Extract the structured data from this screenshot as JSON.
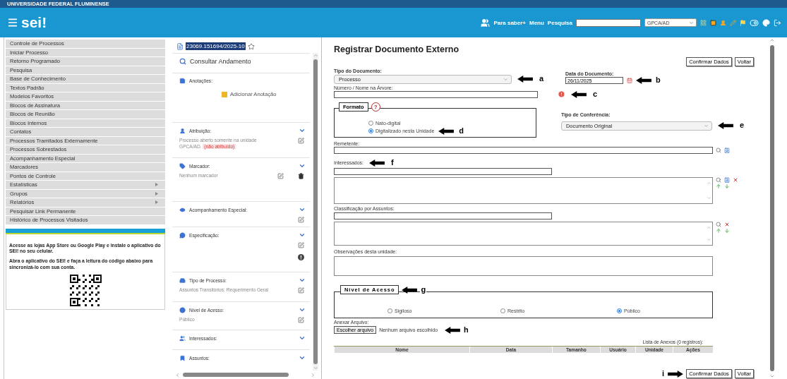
{
  "header": {
    "institution": "UNIVERSIDADE FEDERAL FLUMINENSE",
    "logo": "sei!",
    "links": [
      "Para saber+",
      "Menu",
      "Pesquisa"
    ],
    "unit": "GPCA/AD"
  },
  "sidebar": {
    "menu": [
      {
        "label": "Controle de Processos",
        "has_submenu": false
      },
      {
        "label": "Iniciar Processo",
        "has_submenu": false
      },
      {
        "label": "Retorno Programado",
        "has_submenu": false
      },
      {
        "label": "Pesquisa",
        "has_submenu": false
      },
      {
        "label": "Base de Conhecimento",
        "has_submenu": false
      },
      {
        "label": "Textos Padrão",
        "has_submenu": false
      },
      {
        "label": "Modelos Favoritos",
        "has_submenu": false
      },
      {
        "label": "Blocos de Assinatura",
        "has_submenu": false
      },
      {
        "label": "Blocos de Reunião",
        "has_submenu": false
      },
      {
        "label": "Blocos Internos",
        "has_submenu": false
      },
      {
        "label": "Contatos",
        "has_submenu": false
      },
      {
        "label": "Processos Tramitados Externamente",
        "has_submenu": false
      },
      {
        "label": "Processos Sobrestados",
        "has_submenu": false
      },
      {
        "label": "Acompanhamento Especial",
        "has_submenu": false
      },
      {
        "label": "Marcadores",
        "has_submenu": false
      },
      {
        "label": "Pontos de Controle",
        "has_submenu": false
      },
      {
        "label": "Estatísticas",
        "has_submenu": true
      },
      {
        "label": "Grupos",
        "has_submenu": true
      },
      {
        "label": "Relatórios",
        "has_submenu": true
      },
      {
        "label": "Pesquisar Link Permanente",
        "has_submenu": false
      },
      {
        "label": "Histórico de Processos Visitados",
        "has_submenu": false
      }
    ],
    "app_promo": [
      "Acesse as lojas App Store ou Google Play e instale o aplicativo do SEI! no seu celular.",
      "Abra o aplicativo do SEI! e faça a leitura do código abaixo para sincronizá-lo com sua conta."
    ]
  },
  "process": {
    "number": "23069.151694/2025-10",
    "sections": [
      {
        "kind": "consult",
        "title": "Consultar Andamento"
      },
      {
        "kind": "notes",
        "title": "Anotações:",
        "action": "Adicionar Anotação"
      },
      {
        "kind": "attribution",
        "title": "Atribuição:",
        "text": "Processo aberto somente na unidade GPCA/AD.",
        "badge": "(não atribuído)"
      },
      {
        "kind": "marker",
        "title": "Marcador:",
        "text": "Nenhum marcador"
      },
      {
        "kind": "follow",
        "title": "Acompanhamento Especial:"
      },
      {
        "kind": "spec",
        "title": "Especificação:"
      },
      {
        "kind": "type",
        "title": "Tipo de Processo:",
        "text": "Assuntos Transitórios: Requerimento Geral"
      },
      {
        "kind": "access",
        "title": "Nível de Acesso:",
        "text": "Público"
      },
      {
        "kind": "interested",
        "title": "Interessados:"
      },
      {
        "kind": "subjects",
        "title": "Assuntos:"
      }
    ]
  },
  "form": {
    "title": "Registrar Documento Externo",
    "top_buttons": [
      "Confirmar Dados",
      "Voltar"
    ],
    "tipo_documento": {
      "label": "Tipo do Documento:",
      "value": "Processo",
      "marker": "a"
    },
    "data_documento": {
      "label": "Data do Documento:",
      "value": "26/11/2025",
      "marker": "b"
    },
    "numero": {
      "label": "Número / Nome na Árvore:",
      "marker": "c"
    },
    "formato": {
      "legend": "Formato",
      "help": "?",
      "options": [
        {
          "label": "Nato-digital",
          "selected": false
        },
        {
          "label": "Digitalizado nesta Unidade",
          "selected": true,
          "marker": "d"
        }
      ]
    },
    "tipo_conferencia": {
      "label": "Tipo de Conferência:",
      "value": "Documento Original",
      "marker": "e"
    },
    "remetente": {
      "label": "Remetente:"
    },
    "interessados": {
      "label": "Interessados:",
      "marker": "f"
    },
    "classificacao": {
      "label": "Classificação por Assuntos:"
    },
    "observacoes": {
      "label": "Observações desta unidade:"
    },
    "nivel_acesso": {
      "legend": "Nível de Acesso",
      "marker": "g",
      "options": [
        {
          "label": "Sigiloso",
          "selected": false
        },
        {
          "label": "Restrito",
          "selected": false
        },
        {
          "label": "Público",
          "selected": true
        }
      ]
    },
    "anexar": {
      "label": "Anexar Arquivo:",
      "button": "Escolher arquivo",
      "status": "Nenhum arquivo escolhido",
      "marker": "h"
    },
    "anexos": {
      "caption": "Lista de Anexos (0 registros):",
      "columns": [
        "Nome",
        "Data",
        "Tamanho",
        "Usuário",
        "Unidade",
        "Ações"
      ]
    },
    "bottom_marker": "i",
    "bottom_buttons": [
      "Confirmar Dados",
      "Voltar"
    ]
  }
}
